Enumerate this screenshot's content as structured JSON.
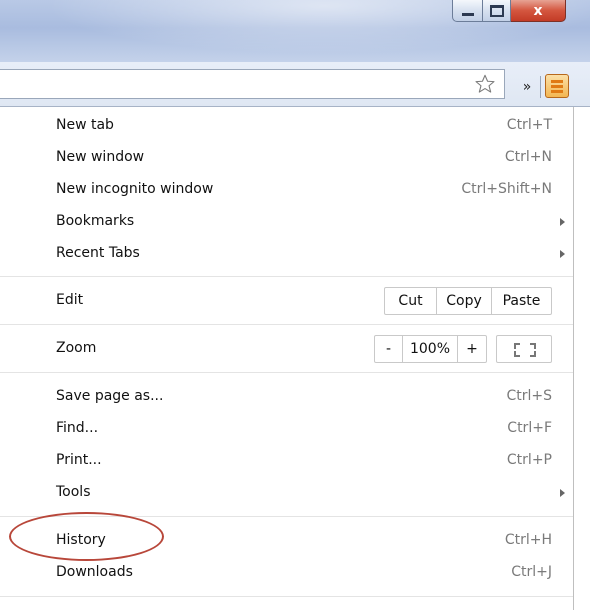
{
  "window": {
    "min_icon": "minimize-icon",
    "max_icon": "maximize-icon",
    "close_glyph": "x"
  },
  "toolbar": {
    "star_icon": "star-icon",
    "extensions_glyph": "»",
    "menu_icon": "hamburger-menu-icon",
    "menu_button_color": "#f3b652"
  },
  "menu": {
    "new_tab": {
      "label": "New tab",
      "shortcut": "Ctrl+T"
    },
    "new_window": {
      "label": "New window",
      "shortcut": "Ctrl+N"
    },
    "new_incognito": {
      "label": "New incognito window",
      "shortcut": "Ctrl+Shift+N"
    },
    "bookmarks": {
      "label": "Bookmarks"
    },
    "recent_tabs": {
      "label": "Recent Tabs"
    },
    "edit": {
      "label": "Edit",
      "cut": "Cut",
      "copy": "Copy",
      "paste": "Paste"
    },
    "zoom": {
      "label": "Zoom",
      "minus": "-",
      "level": "100%",
      "plus": "+"
    },
    "save_page": {
      "label": "Save page as...",
      "shortcut": "Ctrl+S"
    },
    "find": {
      "label": "Find...",
      "shortcut": "Ctrl+F"
    },
    "print": {
      "label": "Print...",
      "shortcut": "Ctrl+P"
    },
    "tools": {
      "label": "Tools"
    },
    "history": {
      "label": "History",
      "shortcut": "Ctrl+H"
    },
    "downloads": {
      "label": "Downloads",
      "shortcut": "Ctrl+J"
    }
  },
  "annotation": {
    "color": "#b8473a"
  }
}
